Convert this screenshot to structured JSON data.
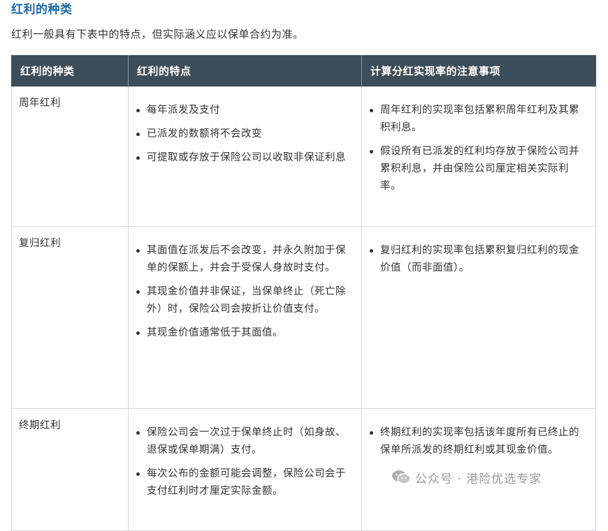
{
  "heading": "红利的种类",
  "intro": "红利一般具有下表中的特点，但实际涵义应以保单合约为准。",
  "table": {
    "headers": [
      "红利的种类",
      "红利的特点",
      "计算分红实现率的注意事项"
    ],
    "rows": [
      {
        "type": "周年红利",
        "features": [
          "每年派发及支付",
          "已派发的数额将不会改变",
          "可提取或存放于保险公司以收取非保证利息"
        ],
        "notes": [
          "周年红利的实现率包括累积周年红利及其累积利息。",
          "假设所有已派发的红利均存放于保险公司并累积利息，并由保险公司厘定相关实际利率。"
        ]
      },
      {
        "type": "复归红利",
        "features": [
          "其面值在派发后不会改变，并永久附加于保单的保额上，并会于受保人身故时支付。",
          "其现金价值并非保证，当保单终止（死亡除外）时，保险公司会按折让价值支付。",
          "其现金价值通常低于其面值。"
        ],
        "notes": [
          "复归红利的实现率包括累积复归红利的现金价值（而非面值）。"
        ]
      },
      {
        "type": "终期红利",
        "features": [
          "保险公司会一次过于保单终止时（如身故、退保或保单期满）支付。",
          "每次公布的金额可能会调整，保险公司会于支付红利时才厘定实际金额。"
        ],
        "notes": [
          "终期红利的实现率包括该年度所有已终止的保单所派发的终期红利或其现金价值。"
        ]
      }
    ]
  },
  "watermark": {
    "icon": "wechat-icon",
    "text": "公众号 · 港险优选专家"
  }
}
